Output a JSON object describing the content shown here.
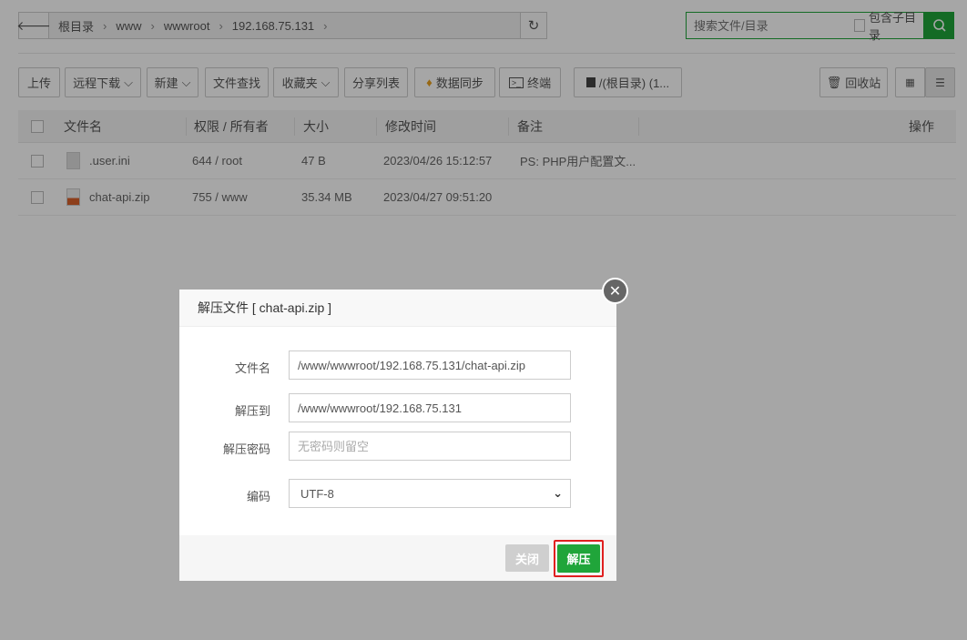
{
  "breadcrumb": {
    "items": [
      "根目录",
      "www",
      "wwwroot",
      "192.168.75.131"
    ],
    "sep": "›"
  },
  "search": {
    "placeholder": "搜索文件/目录",
    "include_sub": "包含子目录"
  },
  "toolbar": {
    "upload": "上传",
    "remote_download": "远程下载",
    "new": "新建",
    "find": "文件查找",
    "favorites": "收藏夹",
    "share_list": "分享列表",
    "data_sync": "数据同步",
    "terminal": "终端",
    "disk": "/(根目录) (1...",
    "recycle": "回收站"
  },
  "table": {
    "headers": {
      "name": "文件名",
      "perm": "权限 / 所有者",
      "size": "大小",
      "mtime": "修改时间",
      "note": "备注",
      "ops": "操作"
    },
    "rows": [
      {
        "name": ".user.ini",
        "perm": "644 / root",
        "size": "47 B",
        "mtime": "2023/04/26 15:12:57",
        "note": "PS: PHP用户配置文...",
        "icon": "text-file-icon"
      },
      {
        "name": "chat-api.zip",
        "perm": "755 / www",
        "size": "35.34 MB",
        "mtime": "2023/04/27 09:51:20",
        "note": "",
        "icon": "zip-file-icon"
      }
    ]
  },
  "dialog": {
    "title": "解压文件 [ chat-api.zip ]",
    "fields": {
      "filename_label": "文件名",
      "filename_value": "/www/wwwroot/192.168.75.131/chat-api.zip",
      "dest_label": "解压到",
      "dest_value": "/www/wwwroot/192.168.75.131",
      "password_label": "解压密码",
      "password_placeholder": "无密码则留空",
      "encoding_label": "编码",
      "encoding_value": "UTF-8"
    },
    "close_label": "关闭",
    "extract_label": "解压"
  },
  "colors": {
    "accent": "#20a53a",
    "highlight": "#e02020"
  }
}
